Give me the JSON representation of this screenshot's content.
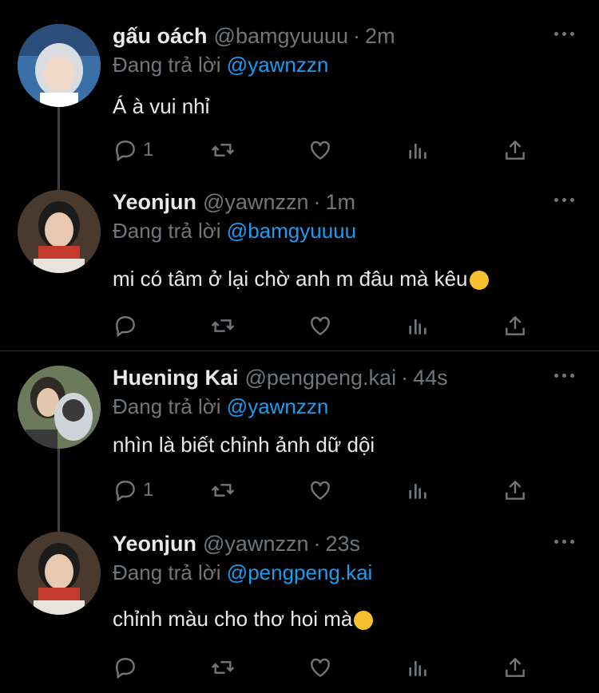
{
  "tweets": [
    {
      "name": "gấu oách",
      "handle": "@bamgyuuuu",
      "time": "2m",
      "reply_label": "Đang trả lời",
      "reply_to": "@yawnzzn",
      "text": "Á à vui nhỉ",
      "reply_count": "1",
      "avatar_colors": [
        "#3b6fa8",
        "#d9dde2",
        "#f1d9c8"
      ]
    },
    {
      "name": "Yeonjun",
      "handle": "@yawnzzn",
      "time": "1m",
      "reply_label": "Đang trả lời",
      "reply_to": "@bamgyuuuu",
      "text": "mi có tâm ở lại chờ anh m đâu mà kêu",
      "reply_count": "",
      "avatar_colors": [
        "#8b5a3c",
        "#c43a2d",
        "#1c1c1c"
      ]
    },
    {
      "name": "Huening Kai",
      "handle": "@pengpeng.kai",
      "time": "44s",
      "reply_label": "Đang trả lời",
      "reply_to": "@yawnzzn",
      "text": "nhìn là biết chỉnh ảnh dữ dội",
      "reply_count": "1",
      "avatar_colors": [
        "#6b7a5a",
        "#cfd4d8",
        "#3a3a3a"
      ]
    },
    {
      "name": "Yeonjun",
      "handle": "@yawnzzn",
      "time": "23s",
      "reply_label": "Đang trả lời",
      "reply_to": "@pengpeng.kai",
      "text": "chỉnh màu cho thơ hoi mà",
      "reply_count": "",
      "avatar_colors": [
        "#8b5a3c",
        "#c43a2d",
        "#1c1c1c"
      ]
    }
  ],
  "icons": {
    "reply": "reply-icon",
    "retweet": "retweet-icon",
    "like": "heart-icon",
    "views": "views-icon",
    "share": "share-icon",
    "more": "more-icon"
  },
  "colors": {
    "background": "#000000",
    "text": "#e7e9ea",
    "muted": "#71767b",
    "link": "#1d9bf0",
    "divider": "#2f3336"
  }
}
